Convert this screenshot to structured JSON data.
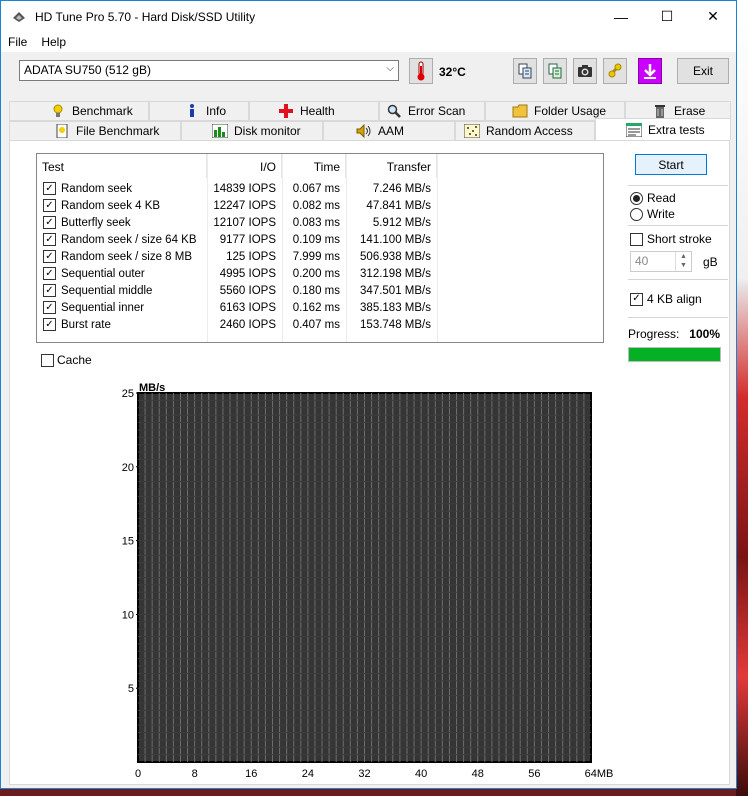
{
  "window": {
    "title": "HD Tune Pro 5.70 - Hard Disk/SSD Utility",
    "controls": {
      "minimize": "—",
      "maximize": "☐",
      "close": "✕"
    }
  },
  "menu": {
    "file": "File",
    "help": "Help"
  },
  "toolbar": {
    "drive": "ADATA SU750 (512 gB)",
    "temperature": "32°C",
    "exit_label": "Exit"
  },
  "tabs": {
    "row1": [
      "Benchmark",
      "Info",
      "Health",
      "Error Scan",
      "Folder Usage",
      "Erase"
    ],
    "row2": [
      "File Benchmark",
      "Disk monitor",
      "AAM",
      "Random Access",
      "Extra tests"
    ],
    "active": "Extra tests"
  },
  "results": {
    "headers": {
      "test": "Test",
      "io": "I/O",
      "time": "Time",
      "transfer": "Transfer"
    },
    "rows": [
      {
        "test": "Random seek",
        "io": "14839 IOPS",
        "time": "0.067 ms",
        "transfer": "7.246 MB/s",
        "checked": true
      },
      {
        "test": "Random seek 4 KB",
        "io": "12247 IOPS",
        "time": "0.082 ms",
        "transfer": "47.841 MB/s",
        "checked": true
      },
      {
        "test": "Butterfly seek",
        "io": "12107 IOPS",
        "time": "0.083 ms",
        "transfer": "5.912 MB/s",
        "checked": true
      },
      {
        "test": "Random seek / size 64 KB",
        "io": "9177 IOPS",
        "time": "0.109 ms",
        "transfer": "141.100 MB/s",
        "checked": true
      },
      {
        "test": "Random seek / size 8 MB",
        "io": "125 IOPS",
        "time": "7.999 ms",
        "transfer": "506.938 MB/s",
        "checked": true
      },
      {
        "test": "Sequential outer",
        "io": "4995 IOPS",
        "time": "0.200 ms",
        "transfer": "312.198 MB/s",
        "checked": true
      },
      {
        "test": "Sequential middle",
        "io": "5560 IOPS",
        "time": "0.180 ms",
        "transfer": "347.501 MB/s",
        "checked": true
      },
      {
        "test": "Sequential inner",
        "io": "6163 IOPS",
        "time": "0.162 ms",
        "transfer": "385.183 MB/s",
        "checked": true
      },
      {
        "test": "Burst rate",
        "io": "2460 IOPS",
        "time": "0.407 ms",
        "transfer": "153.748 MB/s",
        "checked": true
      }
    ]
  },
  "options": {
    "start_label": "Start",
    "read_label": "Read",
    "write_label": "Write",
    "mode_selected": "Read",
    "short_stroke_label": "Short stroke",
    "short_stroke_checked": false,
    "size_value": "40",
    "size_unit": "gB",
    "align_label": "4 KB align",
    "align_checked": true,
    "progress_label": "Progress:",
    "progress_value": "100%",
    "progress_fraction": 1.0,
    "cache_label": "Cache",
    "cache_checked": false
  },
  "chart_data": {
    "type": "line",
    "ylabel": "MB/s",
    "xlabel": "",
    "ylim": [
      0,
      25
    ],
    "xlim": [
      0,
      64
    ],
    "y_ticks": [
      "5",
      "10",
      "15",
      "20",
      "25"
    ],
    "x_ticks": [
      "0",
      "8",
      "16",
      "24",
      "32",
      "40",
      "48",
      "56",
      "64MB"
    ],
    "series": [],
    "grid": true,
    "background": "#353535",
    "grid_color": "#6e6e6e"
  }
}
